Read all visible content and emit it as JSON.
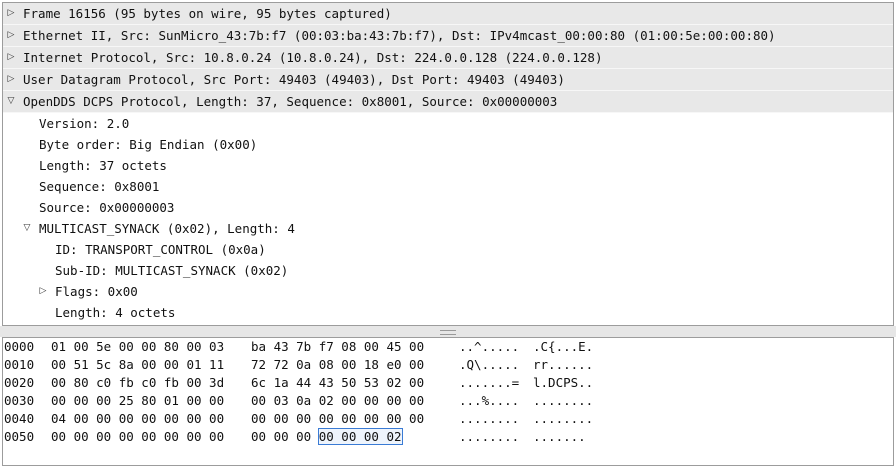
{
  "tree": [
    {
      "level": 0,
      "expander": "collapsed",
      "text": "Frame 16156 (95 bytes on wire, 95 bytes captured)"
    },
    {
      "level": 0,
      "expander": "collapsed",
      "text": "Ethernet II, Src: SunMicro_43:7b:f7 (00:03:ba:43:7b:f7), Dst: IPv4mcast_00:00:80 (01:00:5e:00:00:80)"
    },
    {
      "level": 0,
      "expander": "collapsed",
      "text": "Internet Protocol, Src: 10.8.0.24 (10.8.0.24), Dst: 224.0.0.128 (224.0.0.128)"
    },
    {
      "level": 0,
      "expander": "collapsed",
      "text": "User Datagram Protocol, Src Port: 49403 (49403), Dst Port: 49403 (49403)"
    },
    {
      "level": 0,
      "expander": "expanded",
      "text": "OpenDDS DCPS Protocol, Length: 37, Sequence: 0x8001, Source: 0x00000003"
    },
    {
      "level": 1,
      "expander": "none",
      "text": "Version: 2.0"
    },
    {
      "level": 1,
      "expander": "none",
      "text": "Byte order: Big Endian (0x00)"
    },
    {
      "level": 1,
      "expander": "none",
      "text": "Length: 37 octets"
    },
    {
      "level": 1,
      "expander": "none",
      "text": "Sequence: 0x8001"
    },
    {
      "level": 1,
      "expander": "none",
      "text": "Source: 0x00000003"
    },
    {
      "level": 1,
      "expander": "expanded",
      "text": "MULTICAST_SYNACK (0x02), Length: 4"
    },
    {
      "level": 2,
      "expander": "none",
      "text": "ID: TRANSPORT_CONTROL (0x0a)"
    },
    {
      "level": 2,
      "expander": "none",
      "text": "Sub-ID: MULTICAST_SYNACK (0x02)"
    },
    {
      "level": 2,
      "expander": "collapsed",
      "text": "Flags: 0x00"
    },
    {
      "level": 2,
      "expander": "none",
      "text": "Length: 4 octets"
    }
  ],
  "hex": [
    {
      "offset": "0000",
      "h1": "01 00 5e 00 00 80 00 03",
      "h2": "ba 43 7b f7 08 00 45 00",
      "a1": "..^.....",
      "a2": ".C{...E."
    },
    {
      "offset": "0010",
      "h1": "00 51 5c 8a 00 00 01 11",
      "h2": "72 72 0a 08 00 18 e0 00",
      "a1": ".Q\\.....",
      "a2": "rr......"
    },
    {
      "offset": "0020",
      "h1": "00 80 c0 fb c0 fb 00 3d",
      "h2": "6c 1a 44 43 50 53 02 00",
      "a1": ".......=",
      "a2": "l.DCPS.."
    },
    {
      "offset": "0030",
      "h1": "00 00 00 25 80 01 00 00",
      "h2": "00 03 0a 02 00 00 00 00",
      "a1": "...%....",
      "a2": "........"
    },
    {
      "offset": "0040",
      "h1": "04 00 00 00 00 00 00 00",
      "h2": "00 00 00 00 00 00 00 00",
      "a1": "........",
      "a2": "........"
    },
    {
      "offset": "0050",
      "h1": "00 00 00 00 00 00 00 00",
      "h2_pre": "00 00 00 ",
      "h2_sel": "00 00 00 02",
      "a1": "........",
      "a2": "......."
    }
  ]
}
